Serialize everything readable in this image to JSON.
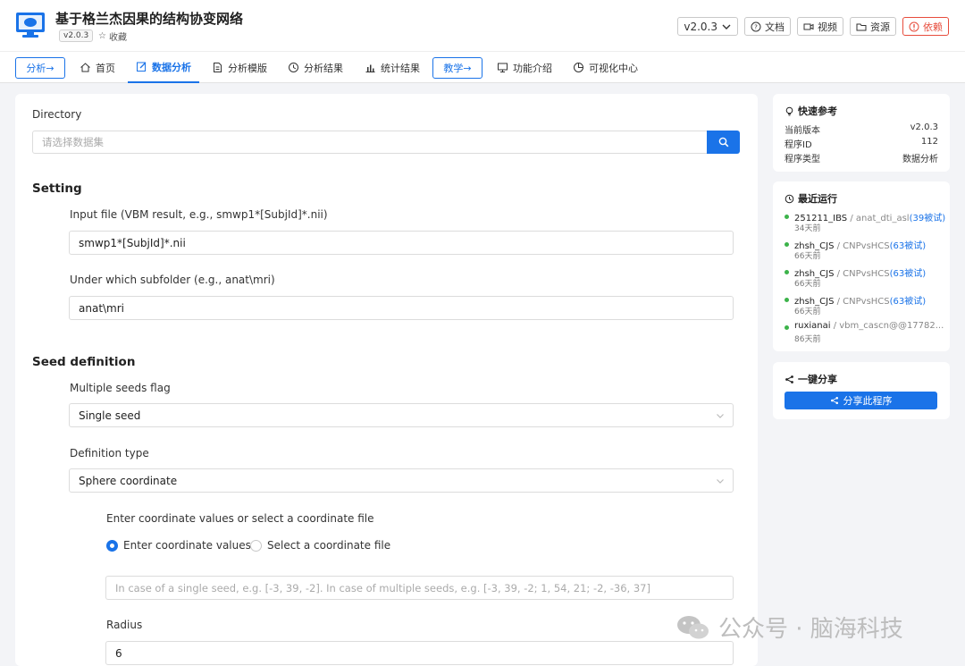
{
  "header": {
    "title": "基于格兰杰因果的结构协变网络",
    "version_tag": "v2.0.3",
    "favorite_label": "收藏",
    "buttons": {
      "version": "v2.0.3",
      "docs": "文档",
      "video": "视频",
      "resources": "资源",
      "deps": "依赖"
    }
  },
  "nav": {
    "analysis_pill": "分析→",
    "home": "首页",
    "data_analysis": "数据分析",
    "templates": "分析模版",
    "results": "分析结果",
    "stats": "统计结果",
    "teach_pill": "教学→",
    "features": "功能介绍",
    "viz_center": "可视化中心"
  },
  "form": {
    "directory_label": "Directory",
    "directory_placeholder": "请选择数据集",
    "setting_title": "Setting",
    "input_file_label": "Input file (VBM result, e.g., smwp1*[SubjId]*.nii)",
    "input_file_value": "smwp1*[SubjId]*.nii",
    "subfolder_label": "Under which subfolder (e.g., anat\\mri)",
    "subfolder_value": "anat\\mri",
    "seed_title": "Seed definition",
    "multiple_seeds_label": "Multiple seeds flag",
    "multiple_seeds_value": "Single seed",
    "definition_type_label": "Definition type",
    "definition_type_value": "Sphere coordinate",
    "coord_prompt": "Enter coordinate values or select a coordinate file",
    "radio_enter": "Enter coordinate values",
    "radio_select": "Select a coordinate file",
    "coord_placeholder": "In case of a single seed, e.g. [-3, 39, -2]. In case of multiple seeds, e.g. [-3, 39, -2; 1, 54, 21; -2, -36, 37]",
    "radius_label": "Radius",
    "radius_value": "6"
  },
  "quick_ref": {
    "title": "快速参考",
    "rows": [
      {
        "key": "当前版本",
        "value": "v2.0.3"
      },
      {
        "key": "程序ID",
        "value": "112"
      },
      {
        "key": "程序类型",
        "value": "数据分析"
      }
    ]
  },
  "recent_runs": {
    "title": "最近运行",
    "items": [
      {
        "user": "251211_IBS",
        "project": "anat_dti_asl",
        "count": "(39被试)",
        "time": "34天前"
      },
      {
        "user": "zhsh_CJS",
        "project": "CNPvsHCS",
        "count": "(63被试)",
        "time": "66天前"
      },
      {
        "user": "zhsh_CJS",
        "project": "CNPvsHCS",
        "count": "(63被试)",
        "time": "66天前"
      },
      {
        "user": "zhsh_CJS",
        "project": "CNPvsHCS",
        "count": "(63被试)",
        "time": "66天前"
      },
      {
        "user": "ruxianai",
        "project": "vbm_cascn@@17782...",
        "count": "",
        "time": "86天前"
      }
    ]
  },
  "share": {
    "title": "一键分享",
    "button": "分享此程序"
  },
  "watermark": "公众号 · 脑海科技",
  "colors": {
    "accent": "#1a73e8",
    "danger": "#e74c3c",
    "online": "#3cb34a"
  }
}
